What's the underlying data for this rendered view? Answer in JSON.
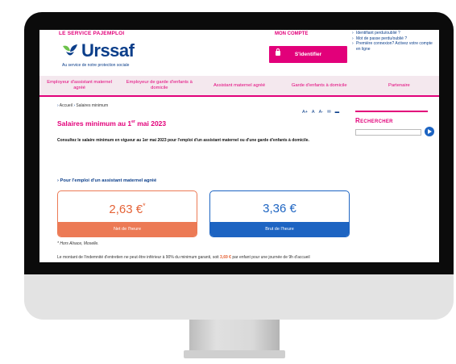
{
  "header": {
    "tagline": "LE SERVICE PAJEMPLOI",
    "logo_text": "Urssaf",
    "logo_subtitle": "Au service de notre protection sociale",
    "account_title": "MON COMPTE",
    "login_label": "S'identifier",
    "account_links": [
      "Identifiant perdu/oublié ?",
      "Mot de passe perdu/oublié ?",
      "Première connexion? Activez votre compte en ligne"
    ]
  },
  "nav": {
    "items": [
      "Employeur d'assistant maternel agréé",
      "Employeur de garde d'enfants à domicile",
      "Assistant maternel agréé",
      "Garde d'enfants à domicile",
      "Partenaire"
    ]
  },
  "breadcrumb": {
    "home": "Accueil",
    "current": "Salaires minimum"
  },
  "tools": [
    "A+",
    "A",
    "A-"
  ],
  "page": {
    "title": "Salaires minimum au 1",
    "title_sup": "er",
    "title_end": " mai 2023",
    "intro": "Consultez le salaire minimum en vigueur au 1er mai 2023 pour l'emploi d'un assistant maternel ou d'une garde d'enfants à domicile.",
    "section_label": "Pour l'emploi d'un assistant maternel agréé",
    "net_value": "2,63 €",
    "net_mark": "*",
    "net_label": "Net de l'heure",
    "brut_value": "3,36 €",
    "brut_label": "Brut de l'heure",
    "note": "* Hors Alsace, Moselle.",
    "para_start": "Le montant de l'indemnité d'entretien ne peut être inférieur à 90% du minimum garanti, soit ",
    "para_highlight": "3,69 €",
    "para_end": " par enfant pour une journée de 9h d'accueil"
  },
  "search": {
    "title_cap": "R",
    "title_rest": "ECHERCHER",
    "placeholder": ""
  },
  "colors": {
    "accent": "#e2007a",
    "brand_blue": "#0b3e8a",
    "net": "#ec7a55",
    "brut": "#1d64c2"
  }
}
